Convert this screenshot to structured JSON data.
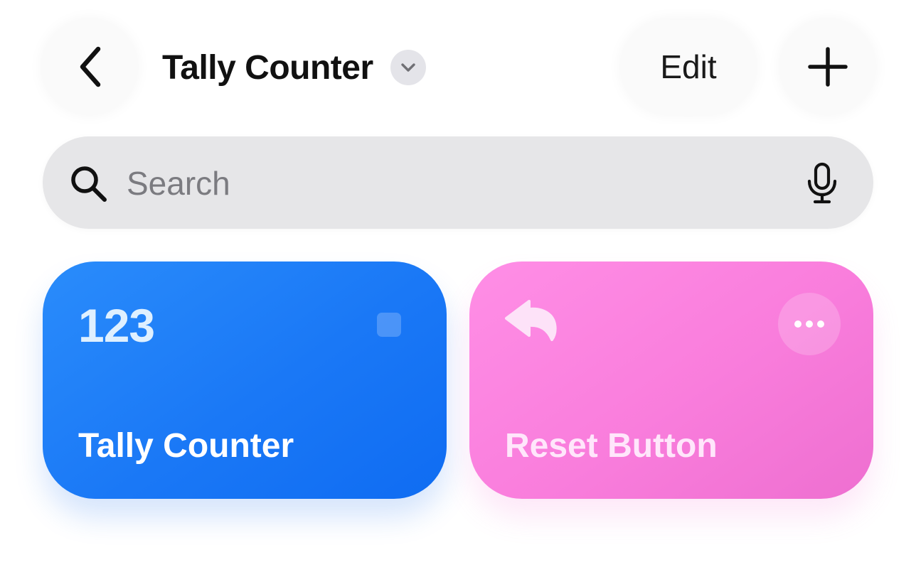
{
  "header": {
    "back_icon": "chevron-left-icon",
    "title": "Tally Counter",
    "title_menu_icon": "chevron-down-icon",
    "edit_label": "Edit",
    "add_icon": "plus-icon"
  },
  "search": {
    "icon": "magnifying-glass-icon",
    "placeholder": "Search",
    "value": "",
    "mic_icon": "microphone-icon"
  },
  "shortcuts": [
    {
      "value": "123",
      "label": "Tally Counter",
      "color": "#1a78f6",
      "icon": "square-icon"
    },
    {
      "label": "Reset Button",
      "color": "#f97ddc",
      "icon": "reply-arrow-icon",
      "more_icon": "ellipsis-icon"
    }
  ]
}
